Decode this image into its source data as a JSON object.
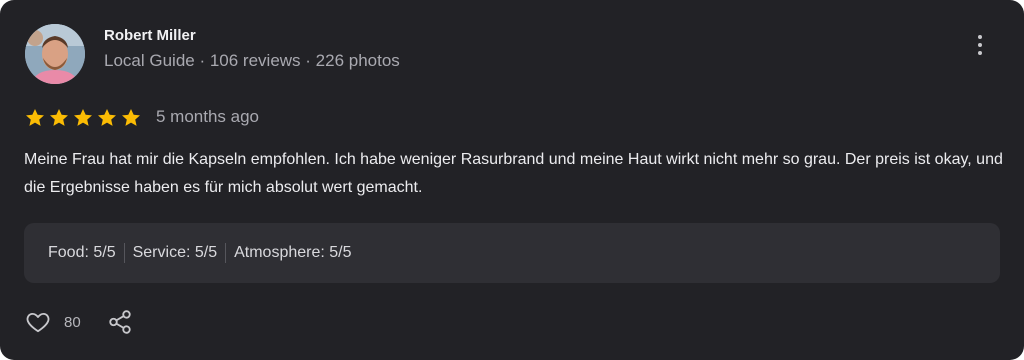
{
  "review": {
    "author": "Robert Miller",
    "author_meta": "Local Guide · 106 reviews · 226 photos",
    "rating": 5,
    "rating_max": 5,
    "time_ago": "5 months ago",
    "text": "Meine Frau hat mir die Kapseln empfohlen. Ich habe weniger Rasurbrand und meine Haut wirkt nicht mehr so grau. Der preis ist okay, und die Ergebnisse haben es für mich absolut wert gemacht.",
    "sub_ratings": [
      "Food: 5/5",
      "Service: 5/5",
      "Atmosphere: 5/5"
    ],
    "like_count": "80"
  },
  "colors": {
    "card_bg": "#222226",
    "star": "#fbbc04",
    "panel_bg": "#2f2f34"
  },
  "icons": {
    "more": "more-vertical-icon",
    "like": "heart-icon",
    "share": "share-icon",
    "star": "star-icon"
  }
}
